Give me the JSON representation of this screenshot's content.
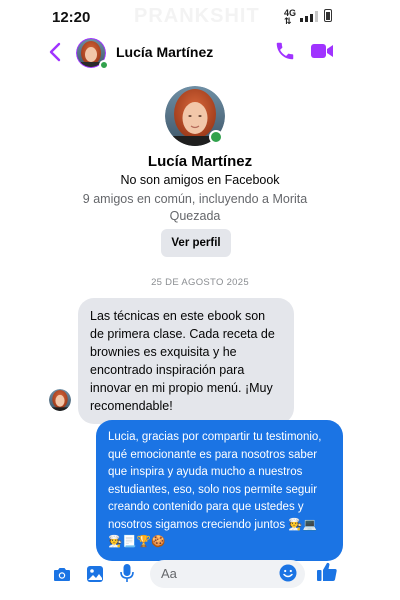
{
  "status_bar": {
    "time": "12:20",
    "watermark": "PRANKSHIT",
    "network": "4G"
  },
  "header": {
    "contact_name": "Lucía Martínez"
  },
  "profile": {
    "name": "Lucía Martínez",
    "friend_status": "No son amigos en Facebook",
    "mutual_friends": "9 amigos en común, incluyendo a Morita Quezada",
    "view_profile_label": "Ver perfil"
  },
  "conversation": {
    "date_separator": "25 DE AGOSTO 2025",
    "messages": [
      {
        "direction": "incoming",
        "text": "Las técnicas en este ebook son de primera clase. Cada receta de brownies es exquisita y he encontrado inspiración para innovar en mi propio menú. ¡Muy recomendable!"
      },
      {
        "direction": "outgoing",
        "text": "Lucia, gracias por compartir tu testimonio, qué emocionante es para nosotros saber que inspira y ayuda mucho a nuestros estudiantes, eso, solo nos permite seguir creando contenido para que ustedes y nosotros sigamos creciendo juntos 🧑‍🍳💻🧑‍🍳📃🏆🍪"
      }
    ]
  },
  "composer": {
    "placeholder": "Aa"
  },
  "icons": {
    "back": "chevron-left-icon",
    "call": "phone-icon",
    "video": "video-camera-icon",
    "camera": "camera-icon",
    "gallery": "image-icon",
    "mic": "microphone-icon",
    "emoji": "smiley-icon",
    "like": "thumbs-up-icon"
  },
  "colors": {
    "messenger_purple": "#a033ff",
    "messenger_blue": "#1b74e4",
    "online_green": "#31a24c",
    "incoming_bubble": "#e4e6eb"
  }
}
